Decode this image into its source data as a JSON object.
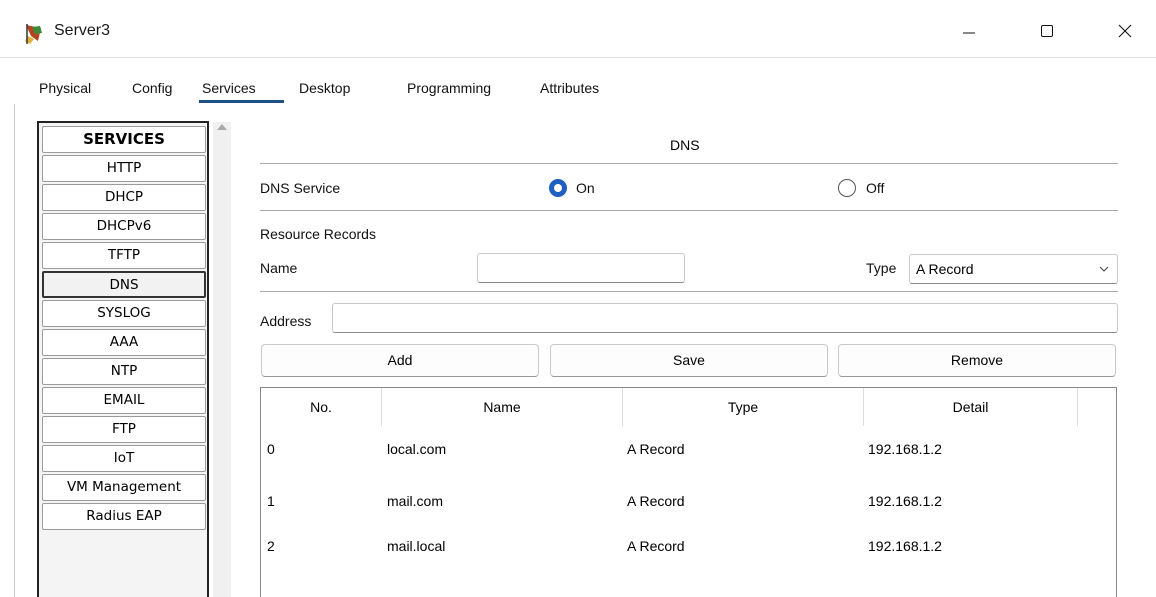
{
  "window": {
    "title": "Server3",
    "icon": "server-app-icon",
    "controls": [
      "minimize-icon",
      "maximize-icon",
      "close-icon"
    ]
  },
  "tabs": [
    {
      "label": "Physical"
    },
    {
      "label": "Config"
    },
    {
      "label": "Services",
      "active": true
    },
    {
      "label": "Desktop"
    },
    {
      "label": "Programming"
    },
    {
      "label": "Attributes"
    }
  ],
  "services": {
    "header": "SERVICES",
    "items": [
      "HTTP",
      "DHCP",
      "DHCPv6",
      "TFTP",
      "DNS",
      "SYSLOG",
      "AAA",
      "NTP",
      "EMAIL",
      "FTP",
      "IoT",
      "VM Management",
      "Radius EAP"
    ],
    "selected": "DNS"
  },
  "dns": {
    "title": "DNS",
    "service_label": "DNS Service",
    "on_label": "On",
    "off_label": "Off",
    "service_state": "On",
    "resource_records_label": "Resource Records",
    "name_label": "Name",
    "name_value": "",
    "type_label": "Type",
    "type_value": "A Record",
    "address_label": "Address",
    "address_value": "",
    "buttons": {
      "add": "Add",
      "save": "Save",
      "remove": "Remove"
    }
  },
  "records": {
    "columns": [
      "No.",
      "Name",
      "Type",
      "Detail"
    ],
    "rows": [
      {
        "no": "0",
        "name": "local.com",
        "type": "A Record",
        "detail": "192.168.1.2"
      },
      {
        "no": "1",
        "name": "mail.com",
        "type": "A Record",
        "detail": "192.168.1.2"
      },
      {
        "no": "2",
        "name": "mail.local",
        "type": "A Record",
        "detail": "192.168.1.2"
      }
    ]
  },
  "colors": {
    "accent": "#1f5fbf",
    "tab_underline": "#1e4f86"
  }
}
